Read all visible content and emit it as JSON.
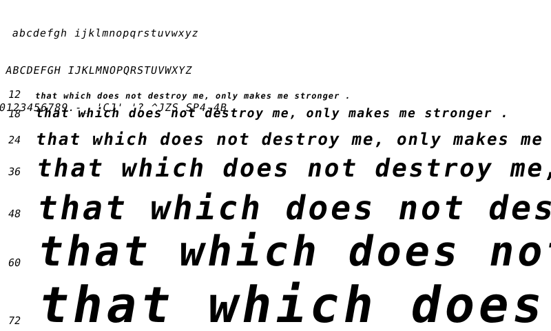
{
  "charset": {
    "lowercase": "abcdefgh ijklmnopqrstuvwxyz",
    "uppercase": "ABCDEFGH IJKLMNOPQRSTUVWXYZ",
    "digits_symbols": "0123456789.-_ 'CJ' '? ^JZS SP4-4B"
  },
  "sample_sentence": "that which does not destroy me, only makes me stronger .",
  "samples": [
    {
      "size": "12"
    },
    {
      "size": "18"
    },
    {
      "size": "24"
    },
    {
      "size": "36"
    },
    {
      "size": "48"
    },
    {
      "size": "60"
    },
    {
      "size": "72"
    }
  ]
}
